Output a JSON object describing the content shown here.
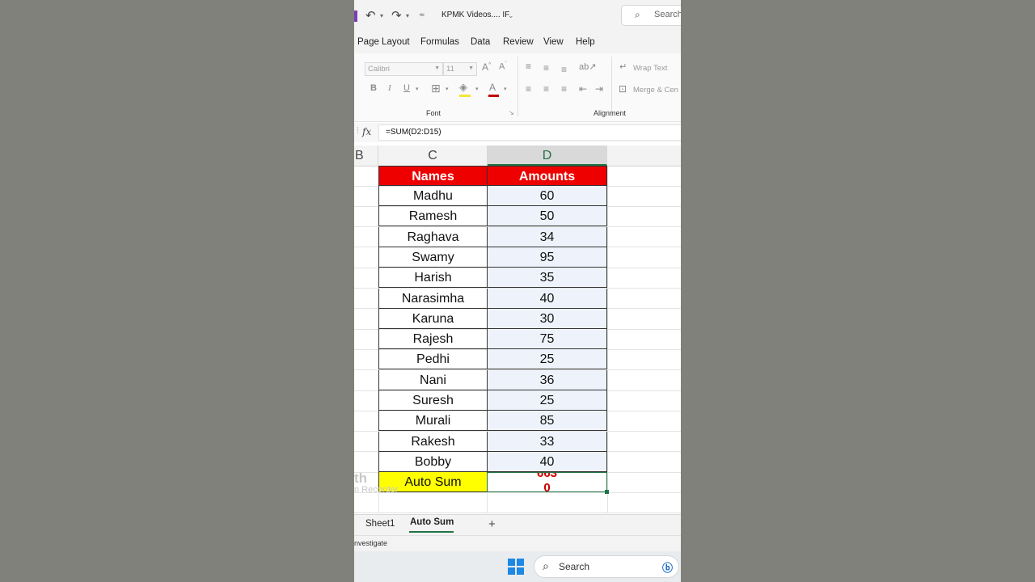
{
  "titlebar": {
    "document_title": "KPMK Videos.... IF",
    "search_label": "Search"
  },
  "menu": {
    "tabs": [
      "Page Layout",
      "Formulas",
      "Data",
      "Review",
      "View",
      "Help"
    ]
  },
  "ribbon": {
    "font_name": "Calibri",
    "font_size": "11",
    "wrap_text_label": "Wrap Text",
    "merge_label": "Merge & Cen",
    "font_group_label": "Font",
    "alignment_group_label": "Alignment"
  },
  "formula_bar": {
    "fx_label": "fx",
    "formula": "=SUM(D2:D15)"
  },
  "grid": {
    "column_headers": [
      "B",
      "C",
      "D"
    ],
    "header_row": {
      "name": "Names",
      "amount": "Amounts"
    },
    "rows": [
      {
        "name": "Madhu",
        "amount": "60"
      },
      {
        "name": "Ramesh",
        "amount": "50"
      },
      {
        "name": "Raghava",
        "amount": "34"
      },
      {
        "name": "Swamy",
        "amount": "95"
      },
      {
        "name": "Harish",
        "amount": "35"
      },
      {
        "name": "Narasimha",
        "amount": "40"
      },
      {
        "name": "Karuna",
        "amount": "30"
      },
      {
        "name": "Rajesh",
        "amount": "75"
      },
      {
        "name": "Pedhi",
        "amount": "25"
      },
      {
        "name": "Nani",
        "amount": "36"
      },
      {
        "name": "Suresh",
        "amount": "25"
      },
      {
        "name": "Murali",
        "amount": "85"
      },
      {
        "name": "Rakesh",
        "amount": "33"
      },
      {
        "name": "Bobby",
        "amount": "40"
      }
    ],
    "total_label": "Auto Sum",
    "total_value_line1": "663",
    "total_value_line2": "0",
    "watermark_line1": "th",
    "watermark_line2": "n Recorder"
  },
  "sheets": {
    "tabs": [
      "Sheet1",
      "Auto Sum"
    ],
    "active": "Auto Sum",
    "add_label": "+"
  },
  "status": {
    "text": "nvestigate"
  },
  "taskbar": {
    "search_label": "Search"
  },
  "colors": {
    "header_fill": "#ee0000",
    "total_fill": "#ffff00",
    "selection": "#217346",
    "total_value_color": "#cc0000"
  }
}
